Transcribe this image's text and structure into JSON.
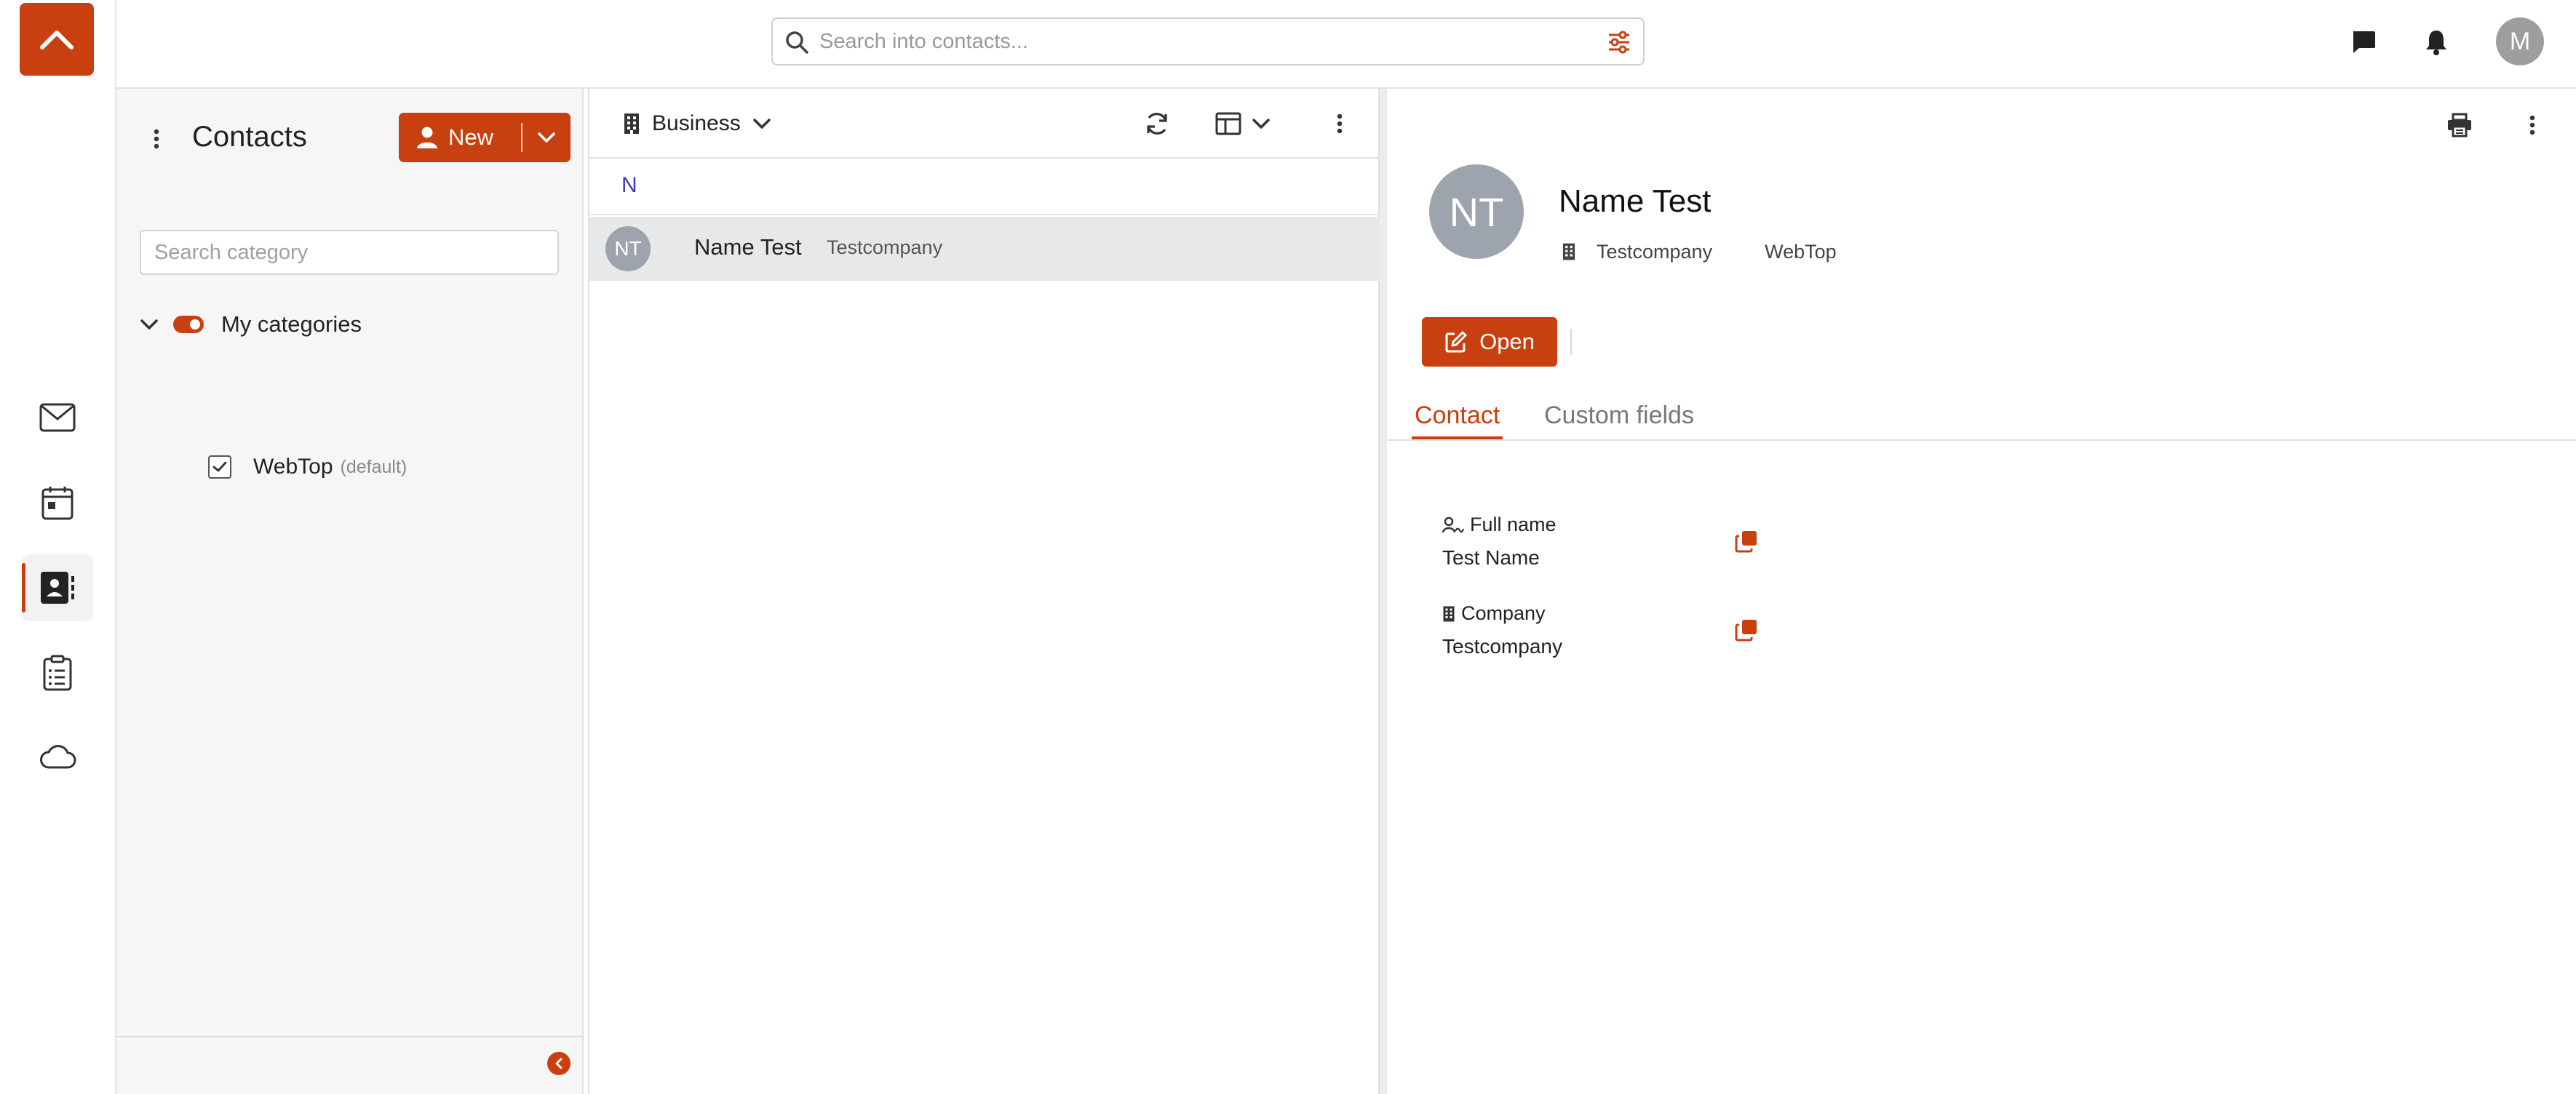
{
  "topbar": {
    "search_placeholder": "Search into contacts...",
    "user_initial": "M"
  },
  "rail": {
    "items": [
      {
        "icon": "mail-icon"
      },
      {
        "icon": "calendar-icon"
      },
      {
        "icon": "contacts-icon",
        "active": true
      },
      {
        "icon": "tasks-icon"
      },
      {
        "icon": "cloud-icon"
      }
    ]
  },
  "sidebar": {
    "title": "Contacts",
    "new_label": "New",
    "category_search_placeholder": "Search category",
    "group_label": "My categories",
    "categories": [
      {
        "name": "WebTop",
        "tag": "(default)",
        "checked": true
      }
    ]
  },
  "list": {
    "view_label": "Business",
    "group_letter": "N",
    "rows": [
      {
        "initials": "NT",
        "name": "Name Test",
        "company": "Testcompany"
      }
    ]
  },
  "detail": {
    "initials": "NT",
    "name": "Name Test",
    "company": "Testcompany",
    "category": "WebTop",
    "open_label": "Open",
    "tabs": [
      {
        "label": "Contact",
        "active": true
      },
      {
        "label": "Custom fields",
        "active": false
      }
    ],
    "fields": [
      {
        "label": "Full name",
        "value": "Test Name"
      },
      {
        "label": "Company",
        "value": "Testcompany"
      }
    ]
  },
  "colors": {
    "accent": "#c8400f",
    "avatar": "#9ea4ad",
    "selected_row": "#e7e8ea",
    "group_letter": "#3b3bb5"
  }
}
